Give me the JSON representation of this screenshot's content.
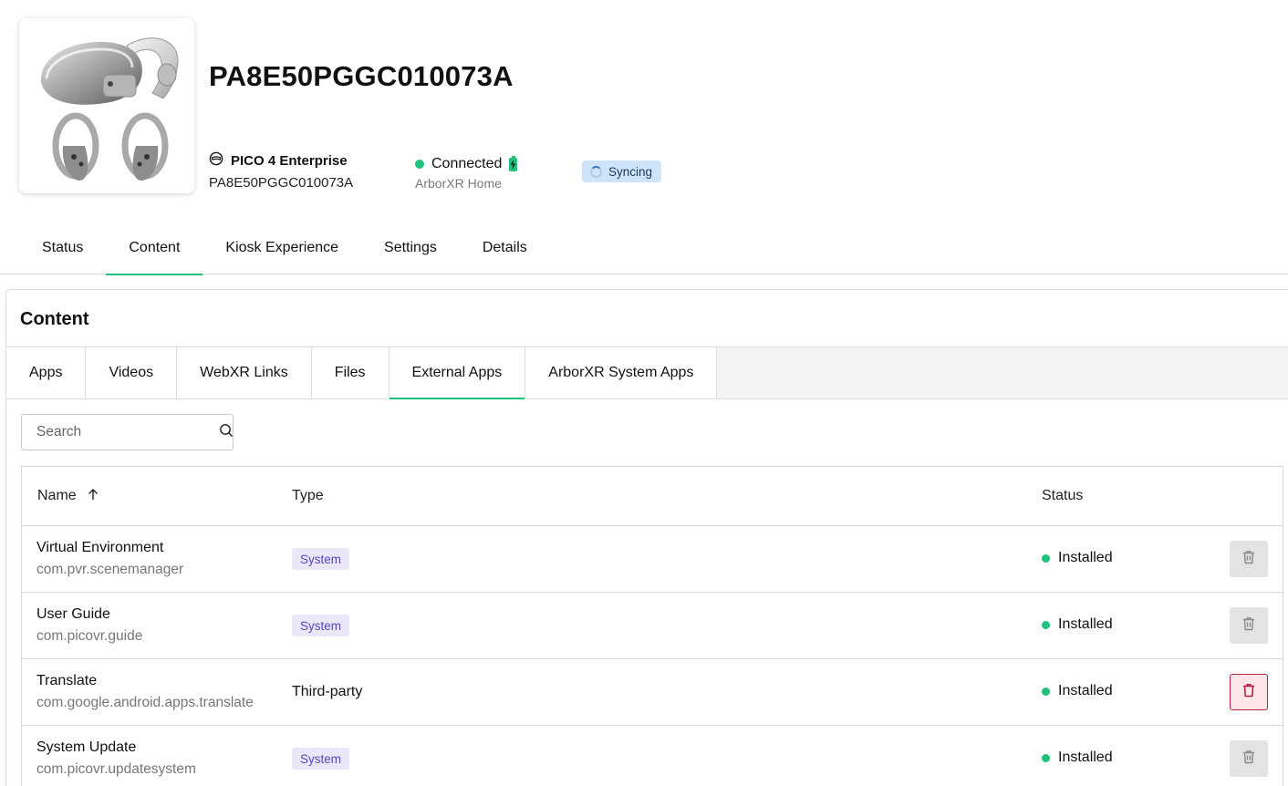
{
  "device": {
    "title": "PA8E50PGGC010073A",
    "model": "PICO 4 Enterprise",
    "serial": "PA8E50PGGC010073A",
    "connection": "Connected",
    "launcher": "ArborXR Home",
    "sync_status": "Syncing"
  },
  "main_tabs": [
    {
      "label": "Status"
    },
    {
      "label": "Content"
    },
    {
      "label": "Kiosk Experience"
    },
    {
      "label": "Settings"
    },
    {
      "label": "Details"
    }
  ],
  "main_tabs_active": "Content",
  "panel": {
    "title": "Content",
    "subtabs": [
      {
        "label": "Apps"
      },
      {
        "label": "Videos"
      },
      {
        "label": "WebXR Links"
      },
      {
        "label": "Files"
      },
      {
        "label": "External Apps"
      },
      {
        "label": "ArborXR System Apps"
      }
    ],
    "subtabs_active": "External Apps",
    "search_placeholder": "Search"
  },
  "table": {
    "headers": {
      "name": "Name",
      "type": "Type",
      "status": "Status"
    },
    "sort": "ascending",
    "rows": [
      {
        "name": "Virtual Environment",
        "package": "com.pvr.scenemanager",
        "type": "System",
        "status": "Installed"
      },
      {
        "name": "User Guide",
        "package": "com.picovr.guide",
        "type": "System",
        "status": "Installed"
      },
      {
        "name": "Translate",
        "package": "com.google.android.apps.translate",
        "type": "Third-party",
        "status": "Installed"
      },
      {
        "name": "System Update",
        "package": "com.picovr.updatesystem",
        "type": "System",
        "status": "Installed"
      }
    ]
  },
  "colors": {
    "accent": "#1fc17b",
    "sync_bg": "#cfe4f8",
    "system_badge_bg": "#e9e8f9",
    "system_badge_text": "#5747c0",
    "delete_hover": "#b3263f"
  },
  "icons": {
    "model": "headset-icon",
    "battery": "battery-charging-icon",
    "sync": "spinner-icon",
    "search": "search-icon",
    "sort": "arrow-up-icon",
    "delete": "trash-icon"
  }
}
